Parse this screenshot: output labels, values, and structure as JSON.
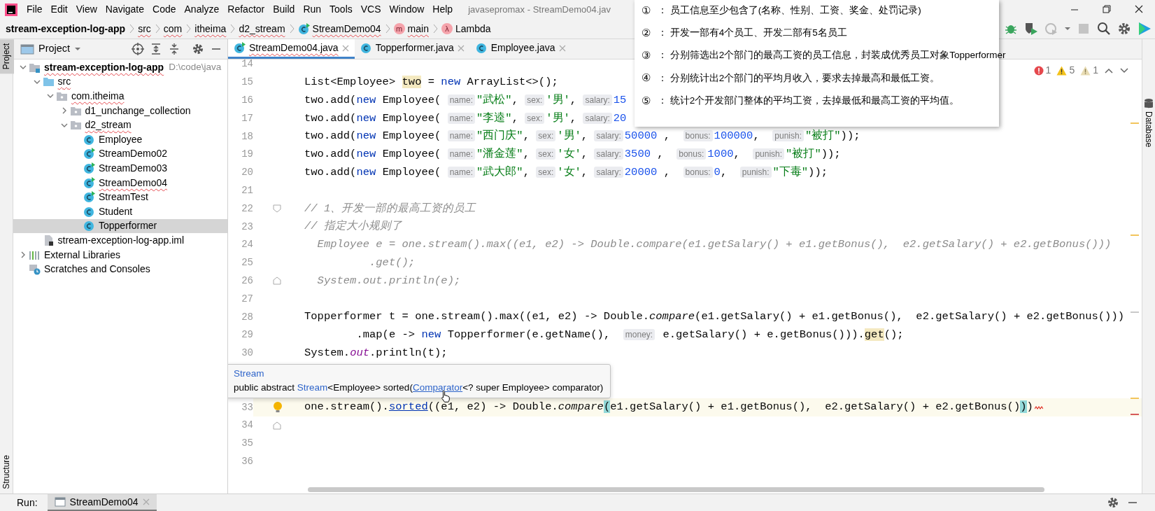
{
  "menu_bar": {
    "items": [
      "File",
      "Edit",
      "View",
      "Navigate",
      "Code",
      "Analyze",
      "Refactor",
      "Build",
      "Run",
      "Tools",
      "VCS",
      "Window",
      "Help"
    ],
    "title": "javasepromax - StreamDemo04.jav"
  },
  "breadcrumbs": [
    {
      "label": "stream-exception-log-app",
      "kind": "module",
      "misspelled": false
    },
    {
      "label": "src",
      "kind": "package",
      "misspelled": true
    },
    {
      "label": "com",
      "kind": "package",
      "misspelled": true
    },
    {
      "label": "itheima",
      "kind": "package",
      "misspelled": true
    },
    {
      "label": "d2_stream",
      "kind": "package",
      "misspelled": true
    },
    {
      "label": "StreamDemo04",
      "kind": "class",
      "misspelled": true
    },
    {
      "label": "main",
      "kind": "method",
      "badge": "m",
      "misspelled": true
    },
    {
      "label": "Lambda",
      "kind": "lambda",
      "badge": "λ",
      "misspelled": false
    }
  ],
  "tool_strips": {
    "left": [
      {
        "label": "Project",
        "selected": true
      },
      {
        "label": "Structure",
        "selected": false
      }
    ],
    "right": [
      {
        "label": "Database"
      }
    ]
  },
  "project_panel": {
    "title": "Project",
    "tree": [
      {
        "label": "stream-exception-log-app",
        "path": "D:\\code\\java",
        "kind": "module",
        "bold": true,
        "misspelled": true,
        "expanded": true,
        "selected": false,
        "children": [
          {
            "label": "src",
            "kind": "src-folder",
            "misspelled": true,
            "expanded": true,
            "selected": false,
            "children": [
              {
                "label": "com.itheima",
                "kind": "package",
                "misspelled": true,
                "expanded": true,
                "selected": false,
                "children": [
                  {
                    "label": "d1_unchange_collection",
                    "kind": "package",
                    "misspelled": false,
                    "expanded": false,
                    "selected": false
                  },
                  {
                    "label": "d2_stream",
                    "kind": "package",
                    "misspelled": true,
                    "expanded": true,
                    "selected": false,
                    "children": [
                      {
                        "label": "Employee",
                        "kind": "class",
                        "misspelled": false,
                        "selected": false
                      },
                      {
                        "label": "StreamDemo02",
                        "kind": "run-class",
                        "misspelled": false,
                        "selected": false
                      },
                      {
                        "label": "StreamDemo03",
                        "kind": "run-class",
                        "misspelled": false,
                        "selected": false
                      },
                      {
                        "label": "StreamDemo04",
                        "kind": "run-class",
                        "misspelled": true,
                        "selected": false
                      },
                      {
                        "label": "StreamTest",
                        "kind": "run-class",
                        "misspelled": false,
                        "selected": false
                      },
                      {
                        "label": "Student",
                        "kind": "class",
                        "misspelled": false,
                        "selected": false
                      },
                      {
                        "label": "Topperformer",
                        "kind": "class",
                        "misspelled": false,
                        "selected": true
                      }
                    ]
                  }
                ]
              }
            ]
          },
          {
            "label": "stream-exception-log-app.iml",
            "kind": "file",
            "misspelled": false,
            "selected": false
          }
        ]
      },
      {
        "label": "External Libraries",
        "kind": "libraries",
        "misspelled": false,
        "expanded": false,
        "selected": false
      },
      {
        "label": "Scratches and Consoles",
        "kind": "scratches",
        "misspelled": false,
        "selected": false
      }
    ]
  },
  "editor": {
    "tabs": [
      {
        "label": "StreamDemo04.java",
        "kind": "run-class",
        "selected": true,
        "misspelled": true
      },
      {
        "label": "Topperformer.java",
        "kind": "class",
        "selected": false,
        "misspelled": false
      },
      {
        "label": "Employee.java",
        "kind": "class",
        "selected": false,
        "misspelled": false
      }
    ],
    "inspections": [
      {
        "kind": "error",
        "count": "1"
      },
      {
        "kind": "warning",
        "count": "5"
      },
      {
        "kind": "weak",
        "count": "1"
      }
    ],
    "lines": [
      {
        "kind": "code",
        "number": "14",
        "current": false
      },
      {
        "kind": "code",
        "number": "15",
        "current": false,
        "tokens": [
          {
            "kind": "plain",
            "text": "List<Employee> "
          },
          {
            "kind": "hl",
            "text": "two"
          },
          {
            "kind": "plain",
            "text": " = "
          },
          {
            "kind": "kw",
            "text": "new"
          },
          {
            "kind": "plain",
            "text": " ArrayList<>();"
          }
        ]
      },
      {
        "kind": "code",
        "number": "16",
        "current": false,
        "tokens": [
          {
            "kind": "plain",
            "text": "two.add("
          },
          {
            "kind": "kw",
            "text": "new"
          },
          {
            "kind": "plain",
            "text": " Employee( "
          },
          {
            "kind": "hint",
            "text": "name:"
          },
          {
            "kind": "str",
            "text": "\"武松\""
          },
          {
            "kind": "plain",
            "text": ", "
          },
          {
            "kind": "hint",
            "text": "sex:"
          },
          {
            "kind": "str",
            "text": "'男'"
          },
          {
            "kind": "plain",
            "text": ", "
          },
          {
            "kind": "hint",
            "text": "salary:"
          },
          {
            "kind": "num",
            "text": "15"
          }
        ]
      },
      {
        "kind": "code",
        "number": "17",
        "current": false,
        "tokens": [
          {
            "kind": "plain",
            "text": "two.add("
          },
          {
            "kind": "kw",
            "text": "new"
          },
          {
            "kind": "plain",
            "text": " Employee( "
          },
          {
            "kind": "hint",
            "text": "name:"
          },
          {
            "kind": "str",
            "text": "\"李逵\""
          },
          {
            "kind": "plain",
            "text": ", "
          },
          {
            "kind": "hint",
            "text": "sex:"
          },
          {
            "kind": "str",
            "text": "'男'"
          },
          {
            "kind": "plain",
            "text": ", "
          },
          {
            "kind": "hint",
            "text": "salary:"
          },
          {
            "kind": "num",
            "text": "20"
          }
        ]
      },
      {
        "kind": "code",
        "number": "18",
        "current": false,
        "tokens": [
          {
            "kind": "plain",
            "text": "two.add("
          },
          {
            "kind": "kw",
            "text": "new"
          },
          {
            "kind": "plain",
            "text": " Employee( "
          },
          {
            "kind": "hint",
            "text": "name:"
          },
          {
            "kind": "str",
            "text": "\"西门庆\""
          },
          {
            "kind": "plain",
            "text": ", "
          },
          {
            "kind": "hint",
            "text": "sex:"
          },
          {
            "kind": "str",
            "text": "'男'"
          },
          {
            "kind": "plain",
            "text": ", "
          },
          {
            "kind": "hint",
            "text": "salary:"
          },
          {
            "kind": "num",
            "text": "50000"
          },
          {
            "kind": "plain",
            "text": " ,  "
          },
          {
            "kind": "hint",
            "text": "bonus:"
          },
          {
            "kind": "num",
            "text": "100000"
          },
          {
            "kind": "plain",
            "text": ",  "
          },
          {
            "kind": "hint",
            "text": "punish:"
          },
          {
            "kind": "str",
            "text": "\"被打\""
          },
          {
            "kind": "plain",
            "text": "));"
          }
        ]
      },
      {
        "kind": "code",
        "number": "19",
        "current": false,
        "tokens": [
          {
            "kind": "plain",
            "text": "two.add("
          },
          {
            "kind": "kw",
            "text": "new"
          },
          {
            "kind": "plain",
            "text": " Employee( "
          },
          {
            "kind": "hint",
            "text": "name:"
          },
          {
            "kind": "str",
            "text": "\"潘金莲\""
          },
          {
            "kind": "plain",
            "text": ", "
          },
          {
            "kind": "hint",
            "text": "sex:"
          },
          {
            "kind": "str",
            "text": "'女'"
          },
          {
            "kind": "plain",
            "text": ", "
          },
          {
            "kind": "hint",
            "text": "salary:"
          },
          {
            "kind": "num",
            "text": "3500"
          },
          {
            "kind": "plain",
            "text": " ,  "
          },
          {
            "kind": "hint",
            "text": "bonus:"
          },
          {
            "kind": "num",
            "text": "1000"
          },
          {
            "kind": "plain",
            "text": ",  "
          },
          {
            "kind": "hint",
            "text": "punish:"
          },
          {
            "kind": "str",
            "text": "\"被打\""
          },
          {
            "kind": "plain",
            "text": "));"
          }
        ]
      },
      {
        "kind": "code",
        "number": "20",
        "current": false,
        "tokens": [
          {
            "kind": "plain",
            "text": "two.add("
          },
          {
            "kind": "kw",
            "text": "new"
          },
          {
            "kind": "plain",
            "text": " Employee( "
          },
          {
            "kind": "hint",
            "text": "name:"
          },
          {
            "kind": "str",
            "text": "\"武大郎\""
          },
          {
            "kind": "plain",
            "text": ", "
          },
          {
            "kind": "hint",
            "text": "sex:"
          },
          {
            "kind": "str",
            "text": "'女'"
          },
          {
            "kind": "plain",
            "text": ", "
          },
          {
            "kind": "hint",
            "text": "salary:"
          },
          {
            "kind": "num",
            "text": "20000"
          },
          {
            "kind": "plain",
            "text": " ,  "
          },
          {
            "kind": "hint",
            "text": "bonus:"
          },
          {
            "kind": "num",
            "text": "0"
          },
          {
            "kind": "plain",
            "text": ",  "
          },
          {
            "kind": "hint",
            "text": "punish:"
          },
          {
            "kind": "str",
            "text": "\"下毒\""
          },
          {
            "kind": "plain",
            "text": "));"
          }
        ]
      },
      {
        "kind": "code",
        "number": "21",
        "current": false
      },
      {
        "kind": "code",
        "number": "22",
        "current": false,
        "marker": {
          "kind": "fold-open"
        },
        "tokens": [
          {
            "kind": "comment",
            "text": "// 1、开发一部的最高工资的员工"
          }
        ]
      },
      {
        "kind": "code",
        "number": "23",
        "current": false,
        "tokens": [
          {
            "kind": "comment",
            "text": "// 指定大小规则了"
          }
        ]
      },
      {
        "kind": "code",
        "number": "24",
        "current": false,
        "tokens": [
          {
            "kind": "comment",
            "text": "  Employee e = one.stream().max((e1, e2) -> Double.compare(e1.getSalary() + e1.getBonus(),  e2.getSalary() + e2.getBonus()))"
          }
        ]
      },
      {
        "kind": "code",
        "number": "25",
        "current": false,
        "tokens": [
          {
            "kind": "comment",
            "text": "          .get();"
          }
        ]
      },
      {
        "kind": "code",
        "number": "26",
        "current": false,
        "marker": {
          "kind": "fold-close"
        },
        "tokens": [
          {
            "kind": "comment",
            "text": "  System.out.println(e);"
          }
        ]
      },
      {
        "kind": "code",
        "number": "27",
        "current": false
      },
      {
        "kind": "code",
        "number": "28",
        "current": false,
        "tokens": [
          {
            "kind": "plain",
            "text": "Topperformer t = one.stream().max((e1, e2) -> Double."
          },
          {
            "kind": "italic",
            "text": "compare"
          },
          {
            "kind": "plain",
            "text": "(e1.getSalary() + e1.getBonus(),  e2.getSalary() + e2.getBonus()))"
          }
        ]
      },
      {
        "kind": "code",
        "number": "29",
        "current": false,
        "tokens": [
          {
            "kind": "plain",
            "text": "        .map(e -> "
          },
          {
            "kind": "kw",
            "text": "new"
          },
          {
            "kind": "plain",
            "text": " Topperformer(e.getName(),  "
          },
          {
            "kind": "hint",
            "text": "money:"
          },
          {
            "kind": "plain",
            "text": " e.getSalary() + e.getBonus()))."
          },
          {
            "kind": "hl",
            "text": "get"
          },
          {
            "kind": "plain",
            "text": "();"
          }
        ]
      },
      {
        "kind": "code",
        "number": "30",
        "current": false,
        "tokens": [
          {
            "kind": "plain",
            "text": "System."
          },
          {
            "kind": "field",
            "text": "out"
          },
          {
            "kind": "plain",
            "text": ".println(t);"
          }
        ]
      },
      {
        "kind": "popup",
        "title": "Stream",
        "signature": [
          {
            "kind": "plain",
            "text": "public abstract "
          },
          {
            "kind": "link",
            "text": "Stream"
          },
          {
            "kind": "plain",
            "text": "<Employee> sorted("
          },
          {
            "kind": "ulink",
            "text": "Comparator"
          },
          {
            "kind": "plain",
            "text": "<? super Employee> comparator)"
          }
        ]
      },
      {
        "kind": "code",
        "number": "33",
        "current": true,
        "marker": {
          "kind": "bulb"
        },
        "error": true,
        "tokens": [
          {
            "kind": "plain",
            "text": "one.stream()."
          },
          {
            "kind": "link",
            "text": "sorted"
          },
          {
            "kind": "plain",
            "text": "((e1, e2) -> Double."
          },
          {
            "kind": "italic",
            "text": "compare"
          },
          {
            "kind": "match",
            "text": "("
          },
          {
            "kind": "plain",
            "text": "e1.getSalary() + e1.getBonus(),  e2.getSalary() + e2.getBonus()"
          },
          {
            "kind": "match",
            "text": ")"
          },
          {
            "kind": "plain",
            "text": ")"
          }
        ]
      },
      {
        "kind": "code",
        "number": "34",
        "current": false,
        "marker": {
          "kind": "fold-close"
        }
      },
      {
        "kind": "code",
        "number": "35",
        "current": false
      },
      {
        "kind": "code",
        "number": "36",
        "current": false
      }
    ]
  },
  "run_bar": {
    "label": "Run:",
    "tabs": [
      {
        "label": "StreamDemo04",
        "selected": true
      }
    ]
  },
  "notes_window": {
    "items": [
      {
        "marker": "①",
        "text": "： 员工信息至少包含了(名称、性别、工资、奖金、处罚记录)"
      },
      {
        "marker": "②",
        "text": "： 开发一部有4个员工、开发二部有5名员工"
      },
      {
        "marker": "③",
        "text": "： 分别筛选出2个部门的最高工资的员工信息，封装成优秀员工对象Topperformer"
      },
      {
        "marker": "④",
        "text": "： 分别统计出2个部门的平均月收入，要求去掉最高和最低工资。"
      },
      {
        "marker": "⑤",
        "text": "： 统计2个开发部门整体的平均工资，去掉最低和最高工资的平均值。"
      }
    ]
  }
}
